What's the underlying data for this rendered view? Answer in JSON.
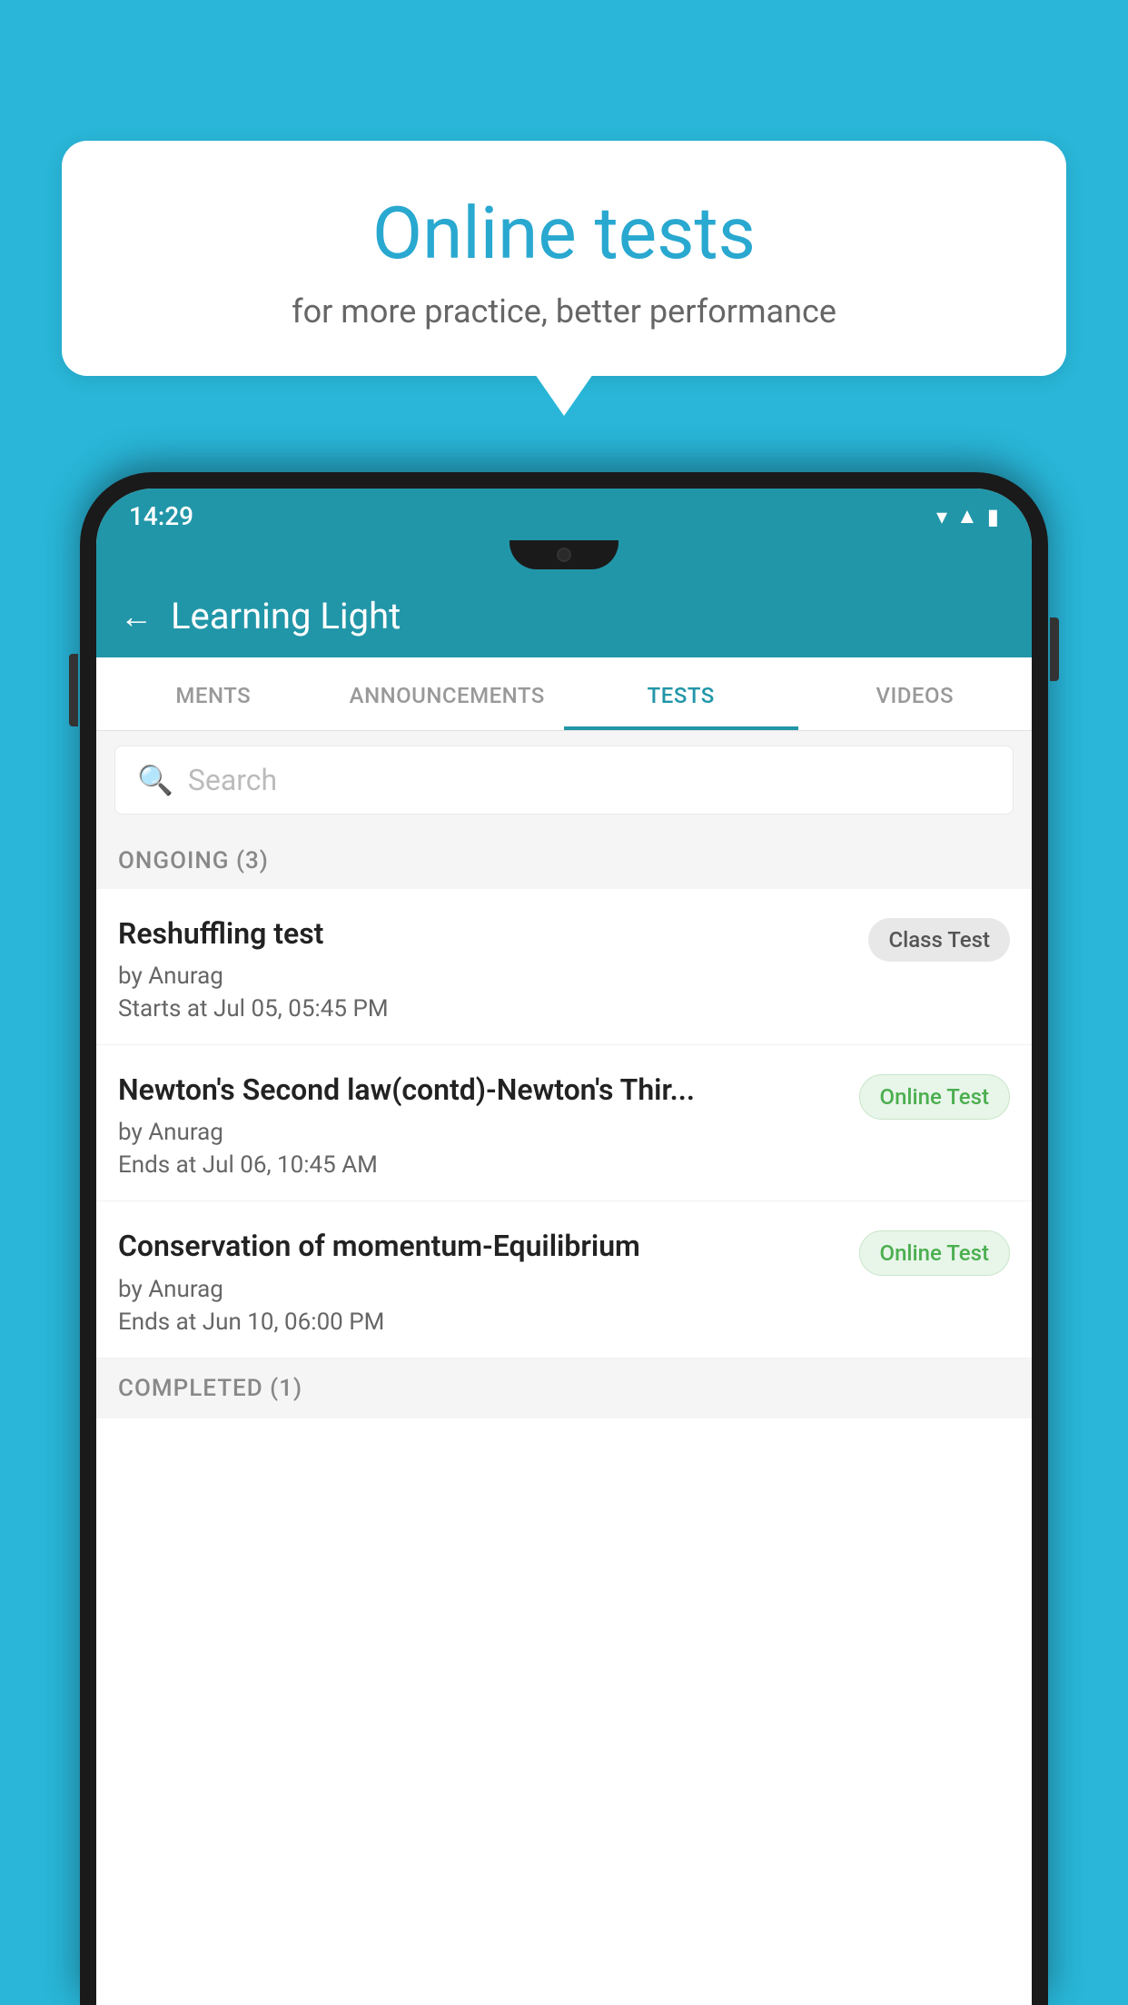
{
  "background_color": "#29b6d8",
  "speech_bubble": {
    "title": "Online tests",
    "subtitle": "for more practice, better performance"
  },
  "phone": {
    "status_bar": {
      "time": "14:29",
      "icons": [
        "wifi",
        "signal",
        "battery"
      ]
    },
    "app_header": {
      "title": "Learning Light",
      "back_label": "←"
    },
    "tabs": [
      {
        "label": "MENTS",
        "active": false
      },
      {
        "label": "ANNOUNCEMENTS",
        "active": false
      },
      {
        "label": "TESTS",
        "active": true
      },
      {
        "label": "VIDEOS",
        "active": false
      }
    ],
    "search": {
      "placeholder": "Search"
    },
    "ongoing_section": {
      "label": "ONGOING (3)",
      "tests": [
        {
          "title": "Reshuffling test",
          "author": "by Anurag",
          "date": "Starts at  Jul 05, 05:45 PM",
          "badge": "Class Test",
          "badge_type": "class"
        },
        {
          "title": "Newton's Second law(contd)-Newton's Thir...",
          "author": "by Anurag",
          "date": "Ends at  Jul 06, 10:45 AM",
          "badge": "Online Test",
          "badge_type": "online"
        },
        {
          "title": "Conservation of momentum-Equilibrium",
          "author": "by Anurag",
          "date": "Ends at  Jun 10, 06:00 PM",
          "badge": "Online Test",
          "badge_type": "online"
        }
      ]
    },
    "completed_section": {
      "label": "COMPLETED (1)"
    }
  }
}
